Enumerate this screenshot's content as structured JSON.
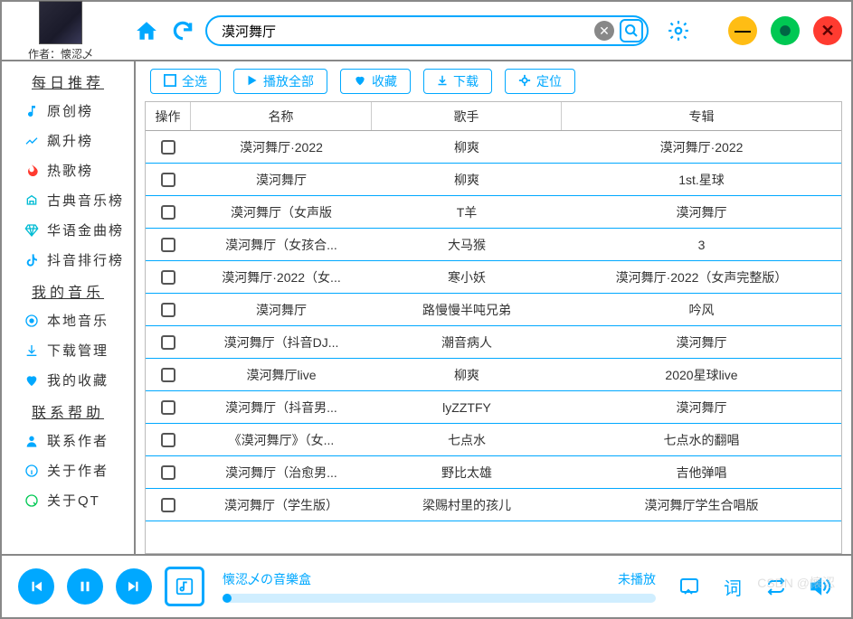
{
  "author_label": "作者：懐涊乄",
  "search": {
    "value": "漠河舞厅",
    "clear_icon": "clear",
    "search_icon": "search"
  },
  "toolbar": {
    "select_all": "全选",
    "play_all": "播放全部",
    "favorite": "收藏",
    "download": "下载",
    "locate": "定位"
  },
  "columns": {
    "op": "操作",
    "name": "名称",
    "artist": "歌手",
    "album": "专辑"
  },
  "sidebar": {
    "s1": "每日推荐",
    "s2": "我的音乐",
    "s3": "联系帮助",
    "items1": [
      {
        "icon": "note",
        "label": "原创榜"
      },
      {
        "icon": "chart",
        "label": "飙升榜"
      },
      {
        "icon": "fire",
        "label": "热歌榜",
        "color": "red"
      },
      {
        "icon": "classic",
        "label": "古典音乐榜",
        "color": "cyan"
      },
      {
        "icon": "diamond",
        "label": "华语金曲榜",
        "color": "cyan"
      },
      {
        "icon": "tiktok",
        "label": "抖音排行榜"
      }
    ],
    "items2": [
      {
        "icon": "disc",
        "label": "本地音乐"
      },
      {
        "icon": "download",
        "label": "下载管理"
      },
      {
        "icon": "heart",
        "label": "我的收藏"
      }
    ],
    "items3": [
      {
        "icon": "user",
        "label": "联系作者"
      },
      {
        "icon": "info",
        "label": "关于作者"
      },
      {
        "icon": "qt",
        "label": "关于QT",
        "color": "green"
      }
    ]
  },
  "rows": [
    {
      "name": "漠河舞厅·2022",
      "artist": "柳爽",
      "album": "漠河舞厅·2022"
    },
    {
      "name": "漠河舞厅",
      "artist": "柳爽",
      "album": "1st.星球"
    },
    {
      "name": "漠河舞厅（女声版",
      "artist": "T羊",
      "album": "漠河舞厅"
    },
    {
      "name": "漠河舞厅（女孩合...",
      "artist": "大马猴",
      "album": "3"
    },
    {
      "name": "漠河舞厅·2022（女...",
      "artist": "寒小妖",
      "album": "漠河舞厅·2022（女声完整版）"
    },
    {
      "name": "漠河舞厅",
      "artist": "路慢慢半吨兄弟",
      "album": "吟风"
    },
    {
      "name": "漠河舞厅（抖音DJ...",
      "artist": "潮音病人",
      "album": "漠河舞厅"
    },
    {
      "name": "漠河舞厅live",
      "artist": "柳爽",
      "album": "2020星球live"
    },
    {
      "name": "漠河舞厅（抖音男...",
      "artist": "lyZZTFY",
      "album": "漠河舞厅"
    },
    {
      "name": "《漠河舞厅》（女...",
      "artist": "七点水",
      "album": "七点水的翻唱"
    },
    {
      "name": "漠河舞厅（治愈男...",
      "artist": "野比太雄",
      "album": "吉他弹唱"
    },
    {
      "name": "漠河舞厅（学生版）",
      "artist": "梁赐村里的孩儿",
      "album": "漠河舞厅学生合唱版"
    }
  ],
  "player": {
    "title": "懐涊乄の音樂盒",
    "status": "未播放",
    "lyric_label": "词"
  },
  "watermark": "CSDN @懐涊"
}
